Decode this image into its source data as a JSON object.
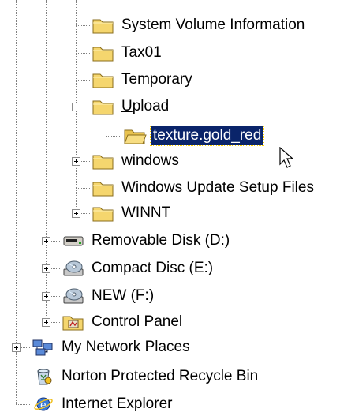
{
  "tree": {
    "items": [
      {
        "label": "System Volume Information",
        "icon": "folder-icon"
      },
      {
        "label": "Tax01",
        "icon": "folder-icon"
      },
      {
        "label": "Temporary",
        "icon": "folder-icon"
      },
      {
        "label": "Upload",
        "icon": "folder-icon",
        "expanded": true,
        "underline": "U"
      },
      {
        "label": "texture.gold_red",
        "icon": "folder-open-icon",
        "selected": true
      },
      {
        "label": "windows",
        "icon": "folder-icon",
        "expandable": true
      },
      {
        "label": "Windows Update Setup Files",
        "icon": "folder-icon"
      },
      {
        "label": "WINNT",
        "icon": "folder-icon",
        "expandable": true
      },
      {
        "label": "Removable Disk (D:)",
        "icon": "removable-disk-icon",
        "expandable": true
      },
      {
        "label": "Compact Disc (E:)",
        "icon": "cd-drive-icon",
        "expandable": true
      },
      {
        "label": "NEW (F:)",
        "icon": "cd-drive-icon",
        "expandable": true
      },
      {
        "label": "Control Panel",
        "icon": "control-panel-icon",
        "expandable": true
      },
      {
        "label": "My Network Places",
        "icon": "network-places-icon",
        "expandable": true
      },
      {
        "label": "Norton Protected Recycle Bin",
        "icon": "recycle-bin-icon"
      },
      {
        "label": "Internet Explorer",
        "icon": "internet-explorer-icon"
      }
    ],
    "upload_rest": "pload"
  },
  "colors": {
    "selection_bg": "#0a246a",
    "selection_text": "#ffffff",
    "folder_yellow": "#f5d66e",
    "connector": "#808080"
  }
}
